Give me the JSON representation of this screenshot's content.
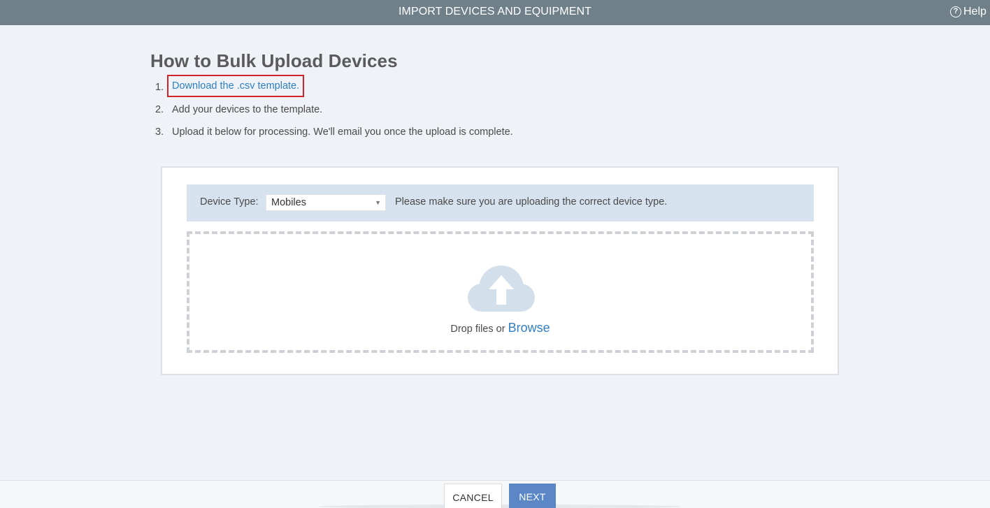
{
  "header": {
    "title": "IMPORT DEVICES AND EQUIPMENT",
    "help_label": "Help",
    "help_icon": "question-circle-icon"
  },
  "main": {
    "title": "How to Bulk Upload Devices",
    "steps": [
      {
        "num": "1.",
        "text": "Download the .csv template."
      },
      {
        "num": "2.",
        "text": "Add your devices to the template."
      },
      {
        "num": "3.",
        "text": "Upload it below for processing. We'll email you once the upload is complete."
      }
    ]
  },
  "device_type": {
    "label": "Device Type:",
    "selected": "Mobiles",
    "note": "Please make sure you are uploading the correct device type."
  },
  "dropzone": {
    "icon": "cloud-upload-icon",
    "text": "Drop files or",
    "browse": "Browse"
  },
  "footer": {
    "cancel": "CANCEL",
    "next": "NEXT"
  },
  "colors": {
    "header_bg": "#6f8089",
    "link": "#2e7fc4",
    "highlight_border": "#d0232a",
    "next_button": "#5b87c7",
    "cloud": "#d3e0ec"
  }
}
